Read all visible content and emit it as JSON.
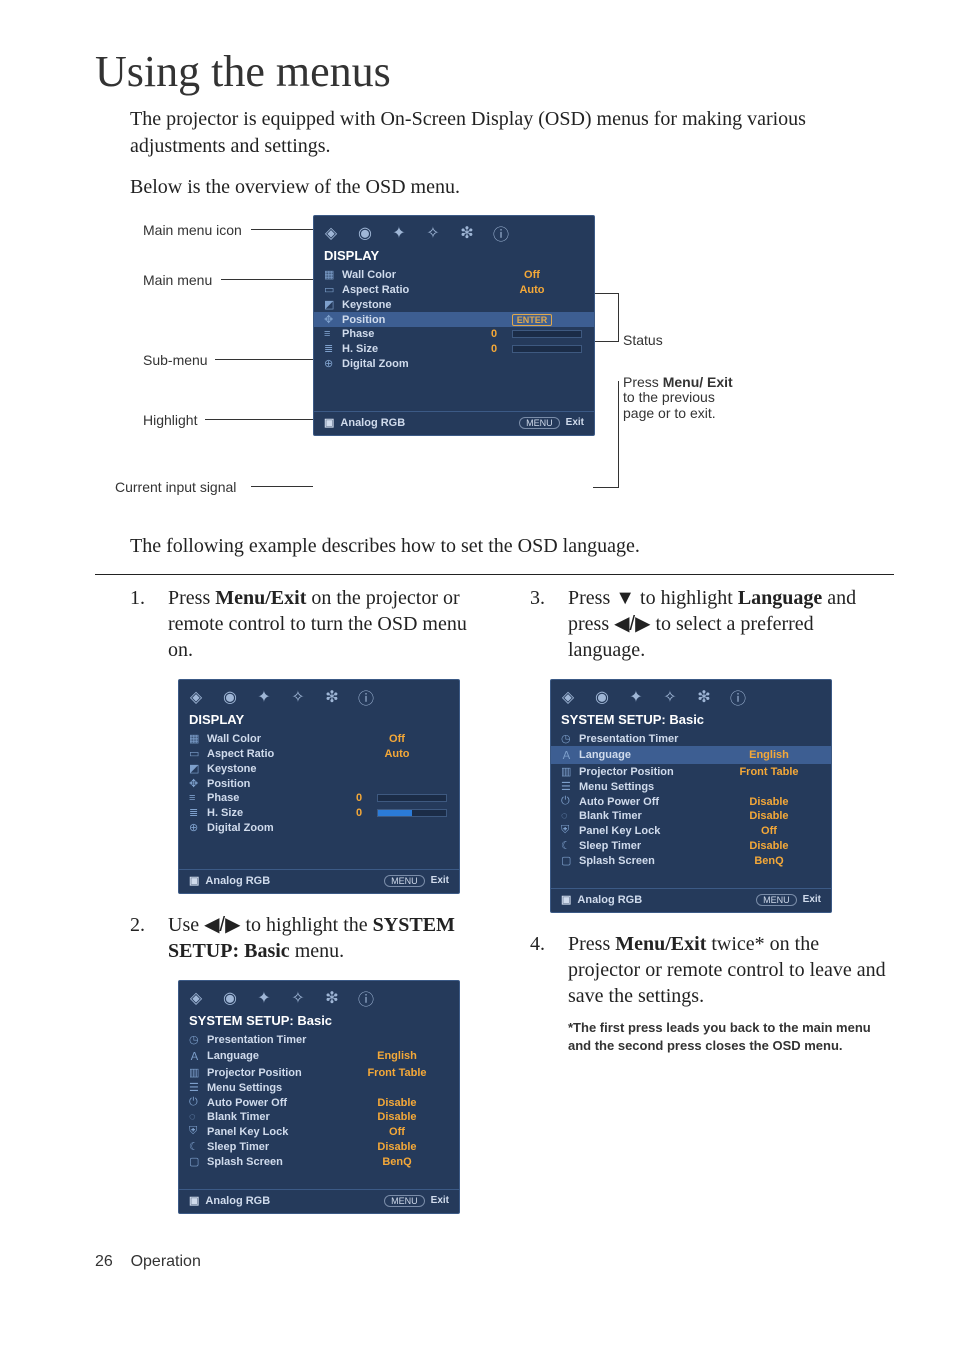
{
  "page": {
    "heading": "Using the menus",
    "intro1": "The projector is equipped with On-Screen Display (OSD) menus for making various adjustments and settings.",
    "intro2": "Below is the overview of the OSD menu.",
    "example": "The following example describes how to set the OSD language.",
    "footer_num": "26",
    "footer_sec": "Operation"
  },
  "overview_labels": {
    "main_icon": "Main menu icon",
    "main_menu": "Main menu",
    "sub_menu": "Sub-menu",
    "highlight": "Highlight",
    "current_signal": "Current input signal",
    "status": "Status",
    "press_menu": "Press Menu/\nExit to the previous page or to exit."
  },
  "osd_display": {
    "title": "DISPLAY",
    "items": [
      {
        "label": "Wall Color",
        "value": "Off",
        "type": "val"
      },
      {
        "label": "Aspect Ratio",
        "value": "Auto",
        "type": "val"
      },
      {
        "label": "Keystone",
        "value": "",
        "type": "none"
      },
      {
        "label": "Position",
        "value": "ENTER",
        "type": "enter"
      },
      {
        "label": "Phase",
        "value": "0",
        "type": "slider"
      },
      {
        "label": "H. Size",
        "value": "0",
        "type": "slider_act"
      },
      {
        "label": "Digital Zoom",
        "value": "",
        "type": "none"
      }
    ],
    "signal": "Analog RGB",
    "menu_btn": "MENU",
    "exit_btn": "Exit"
  },
  "osd_setup": {
    "title": "SYSTEM SETUP: Basic",
    "items": [
      {
        "label": "Presentation Timer",
        "value": ""
      },
      {
        "label": "Language",
        "value": "English"
      },
      {
        "label": "Projector Position",
        "value": "Front Table"
      },
      {
        "label": "Menu Settings",
        "value": ""
      },
      {
        "label": "Auto Power Off",
        "value": "Disable"
      },
      {
        "label": "Blank Timer",
        "value": "Disable"
      },
      {
        "label": "Panel Key Lock",
        "value": "Off"
      },
      {
        "label": "Sleep Timer",
        "value": "Disable"
      },
      {
        "label": "Splash Screen",
        "value": "BenQ"
      }
    ],
    "signal": "Analog RGB",
    "menu_btn": "MENU",
    "exit_btn": "Exit"
  },
  "steps": {
    "s1_num": "1.",
    "s1_a": "Press ",
    "s1_b": "Menu/Exit",
    "s1_c": " on the projector or remote control to turn the OSD menu on.",
    "s2_num": "2.",
    "s2_a": "Use ",
    "s2_b": " to highlight the ",
    "s2_c": "SYSTEM SETUP: Basic",
    "s2_d": " menu.",
    "s3_num": "3.",
    "s3_a": "Press ",
    "s3_b": " to highlight ",
    "s3_c": "Language",
    "s3_d": " and press ",
    "s3_e": " to select a preferred language.",
    "s4_num": "4.",
    "s4_a": "Press ",
    "s4_b": "Menu/Exit",
    "s4_c": " twice* on the projector or remote control to leave and save the settings.",
    "s4_note": "*The first press leads you back to the main menu and the second press closes the OSD menu."
  },
  "glyphs": {
    "left": "◀",
    "right": "▶",
    "down": "▼",
    "slash": "/"
  }
}
